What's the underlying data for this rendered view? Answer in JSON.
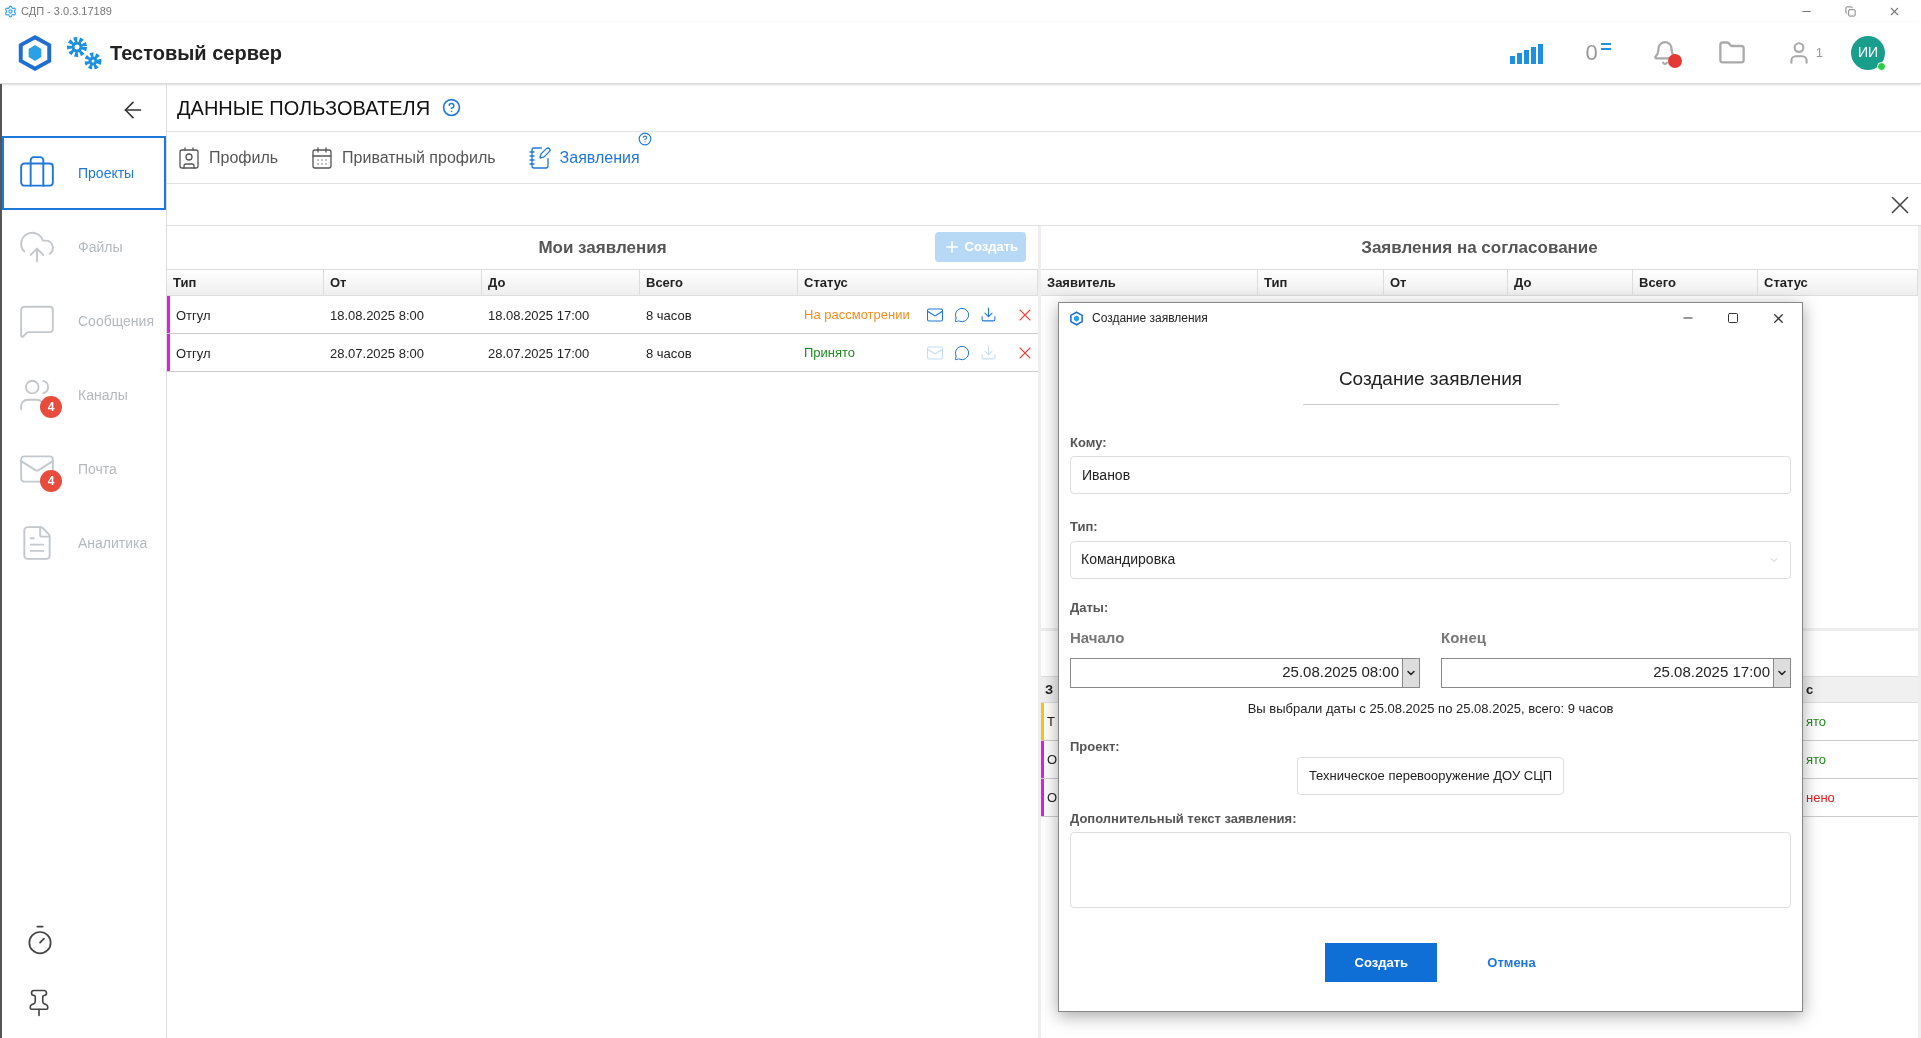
{
  "window": {
    "title": "СДП - 3.0.3.17189"
  },
  "header": {
    "server": "Тестовый сервер",
    "counter": "0",
    "users_count": "1",
    "avatar": "ИИ",
    "notification": true
  },
  "sidebar": {
    "items": [
      {
        "kind": "projects",
        "label": "Проекты",
        "selected": true
      },
      {
        "kind": "files",
        "label": "Файлы",
        "selected": false
      },
      {
        "kind": "messages",
        "label": "Сообщения",
        "selected": false
      },
      {
        "kind": "channels",
        "label": "Каналы",
        "selected": false,
        "badge": "4"
      },
      {
        "kind": "mail",
        "label": "Почта",
        "selected": false,
        "badge": "4"
      },
      {
        "kind": "analytics",
        "label": "Аналитика",
        "selected": false
      }
    ]
  },
  "page": {
    "title": "ДАННЫЕ ПОЛЬЗОВАТЕЛЯ",
    "tabs": [
      {
        "kind": "profile",
        "label": "Профиль",
        "selected": false,
        "help": false
      },
      {
        "kind": "private",
        "label": "Приватный профиль",
        "selected": false,
        "help": false
      },
      {
        "kind": "requests",
        "label": "Заявления",
        "selected": true,
        "help": true
      }
    ]
  },
  "my_requests": {
    "title": "Мои заявления",
    "create_button": {
      "label": "Создать",
      "disabled": true
    },
    "columns": [
      "Тип",
      "От",
      "До",
      "Всего",
      "Статус"
    ],
    "rows": [
      {
        "type": "Отгул",
        "from": "18.08.2025 8:00",
        "to": "18.08.2025 17:00",
        "total": "8 часов",
        "status": "На рассмотрении",
        "kind": "pending",
        "color": "#e020e0",
        "mail_enabled": true,
        "download_enabled": true
      },
      {
        "type": "Отгул",
        "from": "28.07.2025 8:00",
        "to": "28.07.2025 17:00",
        "total": "8 часов",
        "status": "Принято",
        "kind": "accepted",
        "color": "#e020e0",
        "mail_enabled": false,
        "download_enabled": false
      }
    ]
  },
  "approvals": {
    "title": "Заявления на согласование",
    "columns": [
      "Заявитель",
      "Тип",
      "От",
      "До",
      "Всего",
      "Статус"
    ],
    "lower_header": {
      "column_1": "З",
      "column_last": "с"
    },
    "lower_rows": [
      {
        "column_1": "Т",
        "status": "ято",
        "kind": "accepted",
        "color": "#f5c518"
      },
      {
        "column_1": "О",
        "status": "ято",
        "kind": "accepted",
        "color": "#e020e0"
      },
      {
        "column_1": "О",
        "status": "нено",
        "kind": "rejected",
        "color": "#e020e0"
      }
    ]
  },
  "dialog": {
    "title": "Создание заявления",
    "heading": "Создание заявления",
    "to_label": "Кому:",
    "to_value": "Иванов",
    "type_label": "Тип:",
    "type_value": "Командировка",
    "dates_label": "Даты:",
    "start_label": "Начало",
    "start_value": "25.08.2025 08:00",
    "end_label": "Конец",
    "end_value": "25.08.2025 17:00",
    "summary": "Вы выбрали даты с 25.08.2025 по 25.08.2025, всего: 9 часов",
    "project_label": "Проект:",
    "project_value": "Техническое перевооружение ДОУ СЦП",
    "text_label": "Дополнительный текст заявления:",
    "submit": "Создать",
    "cancel": "Отмена"
  }
}
